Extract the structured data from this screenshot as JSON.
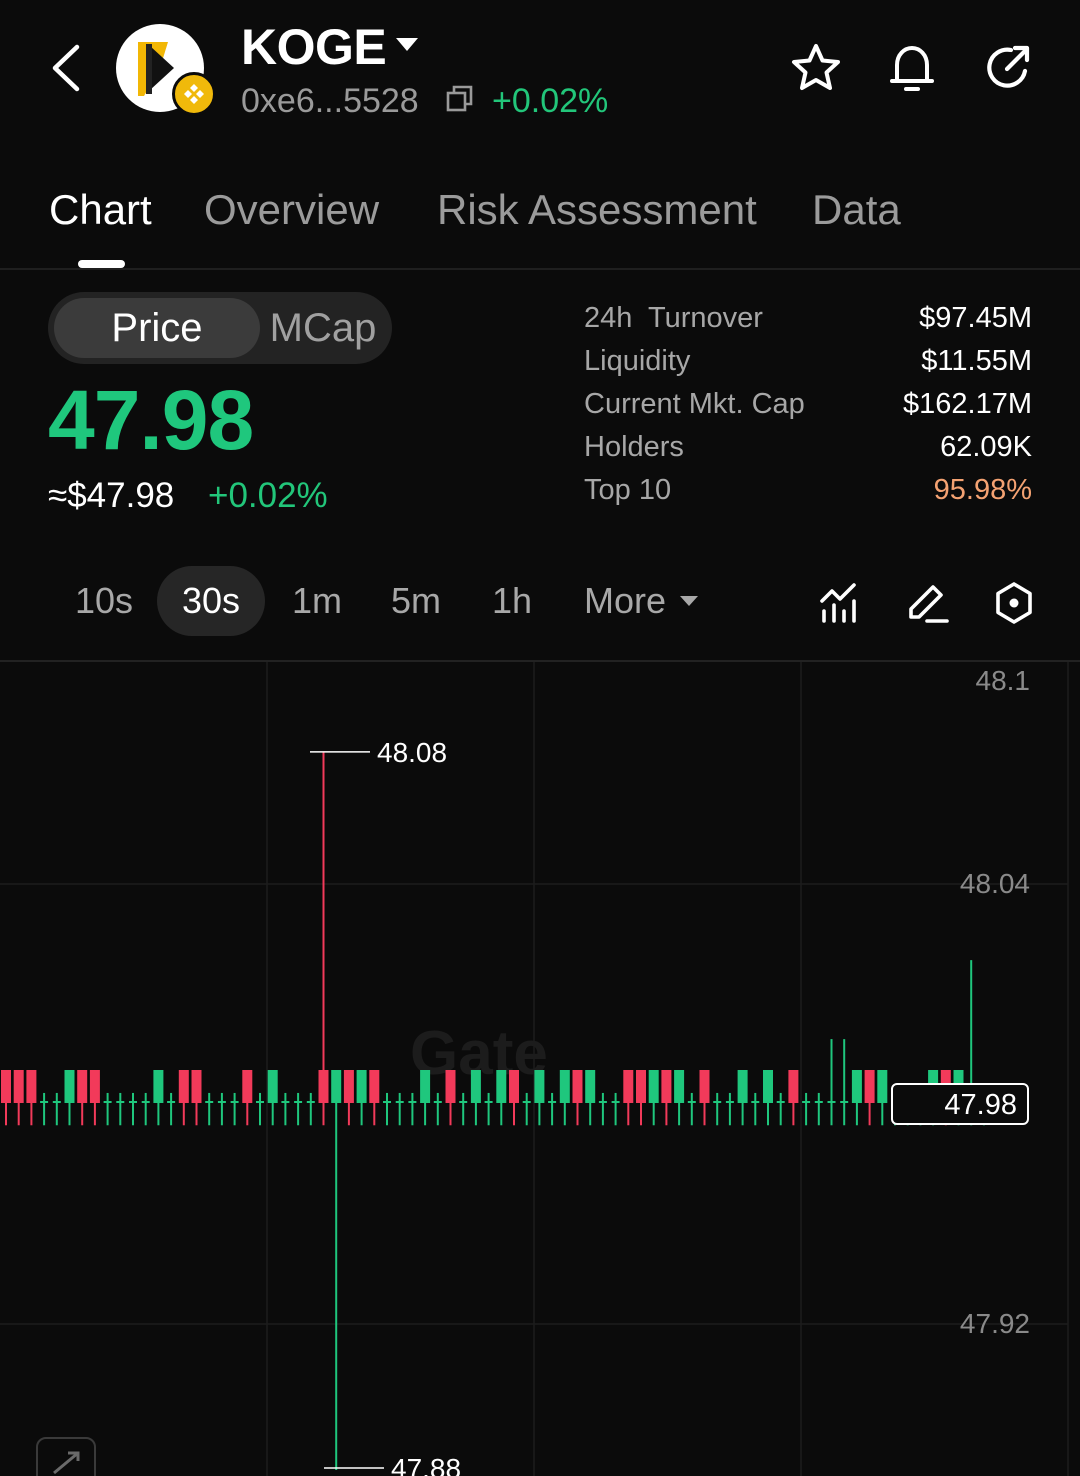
{
  "header": {
    "token_name": "KOGE",
    "address": "0xe6...5528",
    "change": "+0.02%",
    "icons": [
      "back-icon",
      "copy-icon",
      "star-icon",
      "bell-icon",
      "share-icon"
    ]
  },
  "tabs": [
    {
      "label": "Chart",
      "active": true
    },
    {
      "label": "Overview",
      "active": false
    },
    {
      "label": "Risk Assessment",
      "active": false
    },
    {
      "label": "Data",
      "active": false
    }
  ],
  "price_toggle": {
    "selected": "Price",
    "other": "MCap"
  },
  "price": {
    "value": "47.98",
    "usd": "≈$47.98",
    "change": "+0.02%"
  },
  "stats": [
    {
      "label": "24h  Turnover",
      "value": "$97.45M"
    },
    {
      "label": "Liquidity",
      "value": "$11.55M"
    },
    {
      "label": "Current Mkt. Cap",
      "value": "$162.17M"
    },
    {
      "label": "Holders",
      "value": "62.09K"
    },
    {
      "label": "Top 10",
      "value": "95.98%"
    }
  ],
  "intervals": {
    "items": [
      "10s",
      "30s",
      "1m",
      "5m",
      "1h"
    ],
    "selected": "30s",
    "more_label": "More"
  },
  "toolbar_icons": [
    "indicator-icon",
    "draw-icon",
    "settings-icon"
  ],
  "colors": {
    "up": "#1fc77d",
    "down": "#f23a5a",
    "warn": "#f4a272",
    "background": "#0b0b0b"
  },
  "chart_data": {
    "type": "candlestick",
    "interval": "30s",
    "y_axis_ticks": [
      "48.1",
      "48.04",
      "47.92"
    ],
    "ylim": [
      47.88,
      48.1
    ],
    "last_price": "47.98",
    "max_marker": "48.08",
    "min_marker": "47.88",
    "watermark": "Gate",
    "candles": [
      {
        "dir": "down",
        "h": 47.985,
        "l": 47.976
      },
      {
        "dir": "down",
        "h": 47.985,
        "l": 47.976
      },
      {
        "dir": "down",
        "h": 47.985,
        "l": 47.976
      },
      {
        "dir": "flat",
        "h": 47.985,
        "l": 47.976
      },
      {
        "dir": "flat",
        "h": 47.985,
        "l": 47.976
      },
      {
        "dir": "up",
        "h": 47.985,
        "l": 47.976
      },
      {
        "dir": "down",
        "h": 47.985,
        "l": 47.976
      },
      {
        "dir": "down",
        "h": 47.985,
        "l": 47.976
      },
      {
        "dir": "flat",
        "h": 47.985,
        "l": 47.976
      },
      {
        "dir": "flat",
        "h": 47.985,
        "l": 47.976
      },
      {
        "dir": "flat",
        "h": 47.985,
        "l": 47.976
      },
      {
        "dir": "flat",
        "h": 47.985,
        "l": 47.976
      },
      {
        "dir": "up",
        "h": 47.985,
        "l": 47.976
      },
      {
        "dir": "flat",
        "h": 47.985,
        "l": 47.976
      },
      {
        "dir": "down",
        "h": 47.985,
        "l": 47.976
      },
      {
        "dir": "down",
        "h": 47.985,
        "l": 47.976
      },
      {
        "dir": "flat",
        "h": 47.985,
        "l": 47.976
      },
      {
        "dir": "flat",
        "h": 47.985,
        "l": 47.976
      },
      {
        "dir": "flat",
        "h": 47.985,
        "l": 47.976
      },
      {
        "dir": "down",
        "h": 47.985,
        "l": 47.976
      },
      {
        "dir": "flat",
        "h": 47.985,
        "l": 47.976
      },
      {
        "dir": "up",
        "h": 47.985,
        "l": 47.976
      },
      {
        "dir": "flat",
        "h": 47.985,
        "l": 47.976
      },
      {
        "dir": "flat",
        "h": 47.985,
        "l": 47.976
      },
      {
        "dir": "flat",
        "h": 47.985,
        "l": 47.976
      },
      {
        "dir": "down",
        "h": 48.08,
        "l": 47.976
      },
      {
        "dir": "up",
        "h": 47.985,
        "l": 47.88
      },
      {
        "dir": "down",
        "h": 47.985,
        "l": 47.976
      },
      {
        "dir": "up",
        "h": 47.985,
        "l": 47.976
      },
      {
        "dir": "down",
        "h": 47.985,
        "l": 47.976
      },
      {
        "dir": "flat",
        "h": 47.985,
        "l": 47.976
      },
      {
        "dir": "flat",
        "h": 47.985,
        "l": 47.976
      },
      {
        "dir": "flat",
        "h": 47.985,
        "l": 47.976
      },
      {
        "dir": "up",
        "h": 47.985,
        "l": 47.976
      },
      {
        "dir": "flat",
        "h": 47.985,
        "l": 47.976
      },
      {
        "dir": "down",
        "h": 47.985,
        "l": 47.976
      },
      {
        "dir": "flat",
        "h": 47.985,
        "l": 47.976
      },
      {
        "dir": "up",
        "h": 47.985,
        "l": 47.976
      },
      {
        "dir": "flat",
        "h": 47.985,
        "l": 47.976
      },
      {
        "dir": "up",
        "h": 47.985,
        "l": 47.976
      },
      {
        "dir": "down",
        "h": 47.985,
        "l": 47.976
      },
      {
        "dir": "flat",
        "h": 47.985,
        "l": 47.976
      },
      {
        "dir": "up",
        "h": 47.985,
        "l": 47.976
      },
      {
        "dir": "flat",
        "h": 47.985,
        "l": 47.976
      },
      {
        "dir": "up",
        "h": 47.985,
        "l": 47.976
      },
      {
        "dir": "down",
        "h": 47.985,
        "l": 47.976
      },
      {
        "dir": "up",
        "h": 47.985,
        "l": 47.976
      },
      {
        "dir": "flat",
        "h": 47.985,
        "l": 47.976
      },
      {
        "dir": "flat",
        "h": 47.985,
        "l": 47.976
      },
      {
        "dir": "down",
        "h": 47.985,
        "l": 47.976
      },
      {
        "dir": "down",
        "h": 47.985,
        "l": 47.976
      },
      {
        "dir": "up",
        "h": 47.985,
        "l": 47.976
      },
      {
        "dir": "down",
        "h": 47.985,
        "l": 47.976
      },
      {
        "dir": "up",
        "h": 47.985,
        "l": 47.976
      },
      {
        "dir": "flat",
        "h": 47.985,
        "l": 47.976
      },
      {
        "dir": "down",
        "h": 47.985,
        "l": 47.976
      },
      {
        "dir": "flat",
        "h": 47.985,
        "l": 47.976
      },
      {
        "dir": "flat",
        "h": 47.985,
        "l": 47.976
      },
      {
        "dir": "up",
        "h": 47.985,
        "l": 47.976
      },
      {
        "dir": "flat",
        "h": 47.985,
        "l": 47.976
      },
      {
        "dir": "up",
        "h": 47.985,
        "l": 47.976
      },
      {
        "dir": "flat",
        "h": 47.985,
        "l": 47.976
      },
      {
        "dir": "down",
        "h": 47.985,
        "l": 47.976
      },
      {
        "dir": "flat",
        "h": 47.985,
        "l": 47.976
      },
      {
        "dir": "flat",
        "h": 47.985,
        "l": 47.976
      },
      {
        "dir": "flat",
        "h": 48.0,
        "l": 47.976
      },
      {
        "dir": "flat",
        "h": 48.0,
        "l": 47.976
      },
      {
        "dir": "up",
        "h": 47.985,
        "l": 47.976
      },
      {
        "dir": "down",
        "h": 47.985,
        "l": 47.976
      },
      {
        "dir": "up",
        "h": 47.985,
        "l": 47.976
      },
      {
        "dir": "flat",
        "h": 47.985,
        "l": 47.976
      },
      {
        "dir": "flat",
        "h": 47.985,
        "l": 47.976
      },
      {
        "dir": "flat",
        "h": 47.985,
        "l": 47.976
      },
      {
        "dir": "up",
        "h": 47.985,
        "l": 47.976
      },
      {
        "dir": "down",
        "h": 47.985,
        "l": 47.976
      },
      {
        "dir": "up",
        "h": 47.985,
        "l": 47.976
      },
      {
        "dir": "flat",
        "h": 48.022,
        "l": 47.976
      },
      {
        "dir": "flat",
        "h": 47.98,
        "l": 47.976
      }
    ]
  }
}
